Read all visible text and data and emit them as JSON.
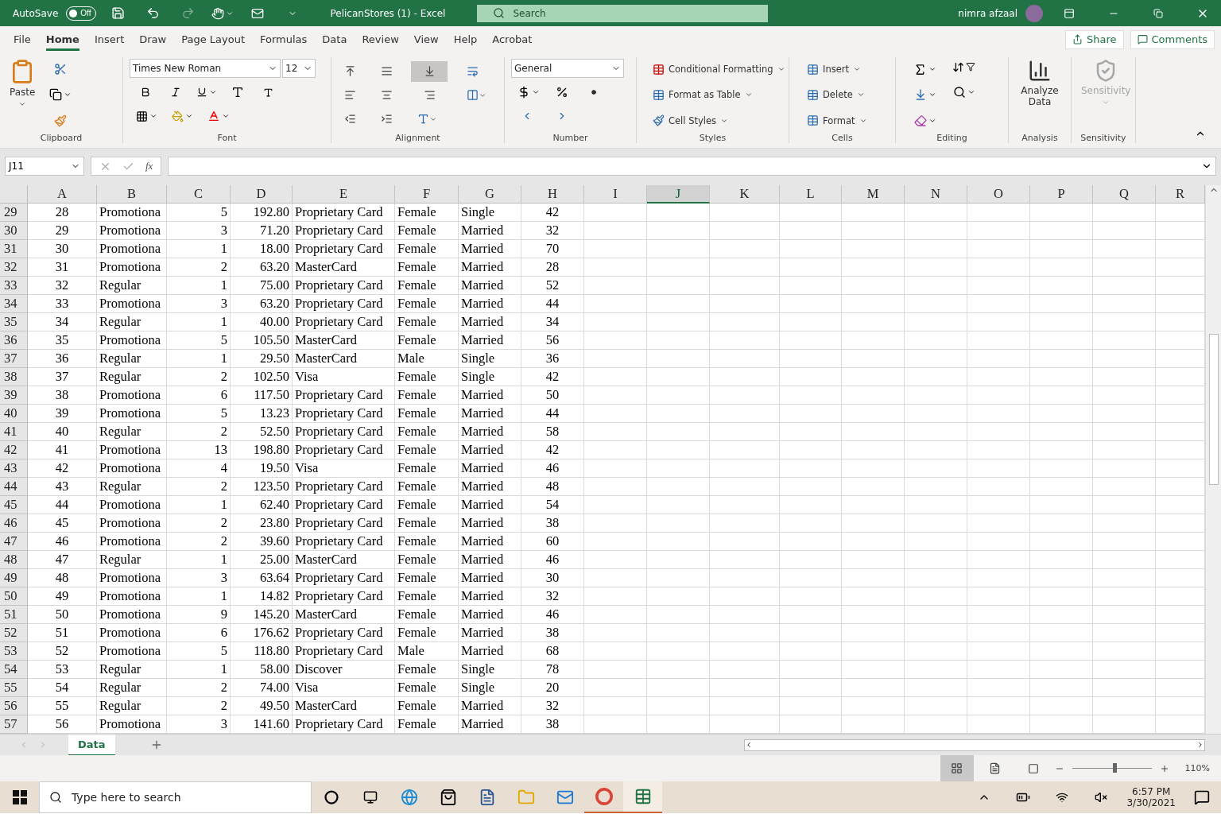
{
  "title_bar": {
    "autosave_label": "AutoSave",
    "autosave": {
      "label": "Off",
      "on": false
    },
    "title": "PelicanStores (1) - Excel",
    "search_placeholder": "Search",
    "user_name": "nimra afzaal"
  },
  "menu_tabs": [
    {
      "label": "File",
      "selected": false
    },
    {
      "label": "Home",
      "selected": true
    },
    {
      "label": "Insert",
      "selected": false
    },
    {
      "label": "Draw",
      "selected": false
    },
    {
      "label": "Page Layout",
      "selected": false
    },
    {
      "label": "Formulas",
      "selected": false
    },
    {
      "label": "Data",
      "selected": false
    },
    {
      "label": "Review",
      "selected": false
    },
    {
      "label": "View",
      "selected": false
    },
    {
      "label": "Help",
      "selected": false
    },
    {
      "label": "Acrobat",
      "selected": false
    }
  ],
  "share_button": "Share",
  "comments_button": "Comments",
  "ribbon": {
    "clipboard": {
      "paste": "Paste",
      "label": "Clipboard"
    },
    "font": {
      "name": "Times New Roman",
      "size": "12",
      "label": "Font"
    },
    "alignment": {
      "label": "Alignment"
    },
    "number": {
      "format": "General",
      "label": "Number"
    },
    "styles": {
      "items": [
        "Conditional Formatting",
        "Format as Table",
        "Cell Styles"
      ],
      "label": "Styles"
    },
    "cells": {
      "items": [
        "Insert",
        "Delete",
        "Format"
      ],
      "label": "Cells"
    },
    "editing": {
      "label": "Editing"
    },
    "analysis": {
      "button": "Analyze Data",
      "label": "Analysis"
    },
    "sensitivity": {
      "button": "Sensitivity",
      "disabled": true,
      "label": "Sensitivity"
    }
  },
  "formula_bar": {
    "name_box": "J11",
    "fx": "fx"
  },
  "columns": [
    {
      "label": "A",
      "selected": false
    },
    {
      "label": "B",
      "selected": false
    },
    {
      "label": "C",
      "selected": false
    },
    {
      "label": "D",
      "selected": false
    },
    {
      "label": "E",
      "selected": false
    },
    {
      "label": "F",
      "selected": false
    },
    {
      "label": "G",
      "selected": false
    },
    {
      "label": "H",
      "selected": false
    },
    {
      "label": "I",
      "selected": false
    },
    {
      "label": "J",
      "selected": true
    },
    {
      "label": "K",
      "selected": false
    },
    {
      "label": "L",
      "selected": false
    },
    {
      "label": "M",
      "selected": false
    },
    {
      "label": "N",
      "selected": false
    },
    {
      "label": "O",
      "selected": false
    },
    {
      "label": "P",
      "selected": false
    },
    {
      "label": "Q",
      "selected": false
    },
    {
      "label": "R",
      "selected": false
    }
  ],
  "rows": [
    {
      "header": "29",
      "cells": [
        "28",
        "Promotiona",
        "5",
        "192.80",
        "Proprietary Card",
        "Female",
        "Single",
        "42"
      ]
    },
    {
      "header": "30",
      "cells": [
        "29",
        "Promotiona",
        "3",
        "71.20",
        "Proprietary Card",
        "Female",
        "Married",
        "32"
      ]
    },
    {
      "header": "31",
      "cells": [
        "30",
        "Promotiona",
        "1",
        "18.00",
        "Proprietary Card",
        "Female",
        "Married",
        "70"
      ]
    },
    {
      "header": "32",
      "cells": [
        "31",
        "Promotiona",
        "2",
        "63.20",
        "MasterCard",
        "Female",
        "Married",
        "28"
      ]
    },
    {
      "header": "33",
      "cells": [
        "32",
        "Regular",
        "1",
        "75.00",
        "Proprietary Card",
        "Female",
        "Married",
        "52"
      ]
    },
    {
      "header": "34",
      "cells": [
        "33",
        "Promotiona",
        "3",
        "63.20",
        "Proprietary Card",
        "Female",
        "Married",
        "44"
      ]
    },
    {
      "header": "35",
      "cells": [
        "34",
        "Regular",
        "1",
        "40.00",
        "Proprietary Card",
        "Female",
        "Married",
        "34"
      ]
    },
    {
      "header": "36",
      "cells": [
        "35",
        "Promotiona",
        "5",
        "105.50",
        "MasterCard",
        "Female",
        "Married",
        "56"
      ]
    },
    {
      "header": "37",
      "cells": [
        "36",
        "Regular",
        "1",
        "29.50",
        "MasterCard",
        "Male",
        "Single",
        "36"
      ]
    },
    {
      "header": "38",
      "cells": [
        "37",
        "Regular",
        "2",
        "102.50",
        "Visa",
        "Female",
        "Single",
        "42"
      ]
    },
    {
      "header": "39",
      "cells": [
        "38",
        "Promotiona",
        "6",
        "117.50",
        "Proprietary Card",
        "Female",
        "Married",
        "50"
      ]
    },
    {
      "header": "40",
      "cells": [
        "39",
        "Promotiona",
        "5",
        "13.23",
        "Proprietary Card",
        "Female",
        "Married",
        "44"
      ]
    },
    {
      "header": "41",
      "cells": [
        "40",
        "Regular",
        "2",
        "52.50",
        "Proprietary Card",
        "Female",
        "Married",
        "58"
      ]
    },
    {
      "header": "42",
      "cells": [
        "41",
        "Promotiona",
        "13",
        "198.80",
        "Proprietary Card",
        "Female",
        "Married",
        "42"
      ]
    },
    {
      "header": "43",
      "cells": [
        "42",
        "Promotiona",
        "4",
        "19.50",
        "Visa",
        "Female",
        "Married",
        "46"
      ]
    },
    {
      "header": "44",
      "cells": [
        "43",
        "Regular",
        "2",
        "123.50",
        "Proprietary Card",
        "Female",
        "Married",
        "48"
      ]
    },
    {
      "header": "45",
      "cells": [
        "44",
        "Promotiona",
        "1",
        "62.40",
        "Proprietary Card",
        "Female",
        "Married",
        "54"
      ]
    },
    {
      "header": "46",
      "cells": [
        "45",
        "Promotiona",
        "2",
        "23.80",
        "Proprietary Card",
        "Female",
        "Married",
        "38"
      ]
    },
    {
      "header": "47",
      "cells": [
        "46",
        "Promotiona",
        "2",
        "39.60",
        "Proprietary Card",
        "Female",
        "Married",
        "60"
      ]
    },
    {
      "header": "48",
      "cells": [
        "47",
        "Regular",
        "1",
        "25.00",
        "MasterCard",
        "Female",
        "Married",
        "46"
      ]
    },
    {
      "header": "49",
      "cells": [
        "48",
        "Promotiona",
        "3",
        "63.64",
        "Proprietary Card",
        "Female",
        "Married",
        "30"
      ]
    },
    {
      "header": "50",
      "cells": [
        "49",
        "Promotiona",
        "1",
        "14.82",
        "Proprietary Card",
        "Female",
        "Married",
        "32"
      ]
    },
    {
      "header": "51",
      "cells": [
        "50",
        "Promotiona",
        "9",
        "145.20",
        "MasterCard",
        "Female",
        "Married",
        "46"
      ]
    },
    {
      "header": "52",
      "cells": [
        "51",
        "Promotiona",
        "6",
        "176.62",
        "Proprietary Card",
        "Female",
        "Married",
        "38"
      ]
    },
    {
      "header": "53",
      "cells": [
        "52",
        "Promotiona",
        "5",
        "118.80",
        "Proprietary Card",
        "Male",
        "Married",
        "68"
      ]
    },
    {
      "header": "54",
      "cells": [
        "53",
        "Regular",
        "1",
        "58.00",
        "Discover",
        "Female",
        "Single",
        "78"
      ]
    },
    {
      "header": "55",
      "cells": [
        "54",
        "Regular",
        "2",
        "74.00",
        "Visa",
        "Female",
        "Single",
        "20"
      ]
    },
    {
      "header": "56",
      "cells": [
        "55",
        "Regular",
        "2",
        "49.50",
        "MasterCard",
        "Female",
        "Married",
        "32"
      ]
    },
    {
      "header": "57",
      "cells": [
        "56",
        "Promotiona",
        "3",
        "141.60",
        "Proprietary Card",
        "Female",
        "Married",
        "38"
      ]
    }
  ],
  "sheet_tabs": [
    {
      "label": "Data",
      "selected": true
    }
  ],
  "status_bar": {
    "zoom": {
      "level": 0.53
    },
    "zoom_label": "110%"
  },
  "taskbar": {
    "search_placeholder": "Type here to search",
    "time": "6:57 PM",
    "date": "3/30/2021"
  }
}
